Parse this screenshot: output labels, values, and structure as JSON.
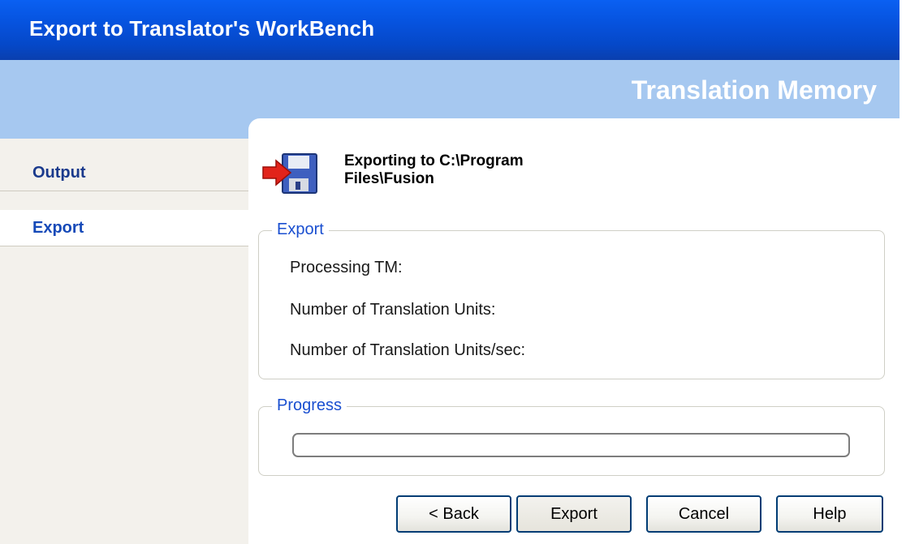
{
  "window": {
    "title": "Export to Translator's WorkBench"
  },
  "banner": {
    "heading": "Translation Memory"
  },
  "sidebar": {
    "items": [
      {
        "label": "Output",
        "active": false
      },
      {
        "label": "Export",
        "active": true
      }
    ]
  },
  "main": {
    "header_line1": "Exporting to C:\\Program",
    "header_line2": "Files\\Fusion",
    "header_icon": "save-export-icon",
    "export_group": {
      "legend": "Export",
      "fields": [
        "Processing TM:",
        "Number of Translation Units:",
        "Number of Translation Units/sec:"
      ]
    },
    "progress_group": {
      "legend": "Progress",
      "progress": 0
    }
  },
  "buttons": {
    "back": "< Back",
    "export": "Export",
    "cancel": "Cancel",
    "help": "Help"
  },
  "colors": {
    "titlebar": "#0652dd",
    "banner": "#a6c8f0",
    "sidebar_bg": "#f3f1ec",
    "nav_text": "#1a3a8c",
    "legend_text": "#1a4fd0",
    "button_border": "#003c74"
  }
}
